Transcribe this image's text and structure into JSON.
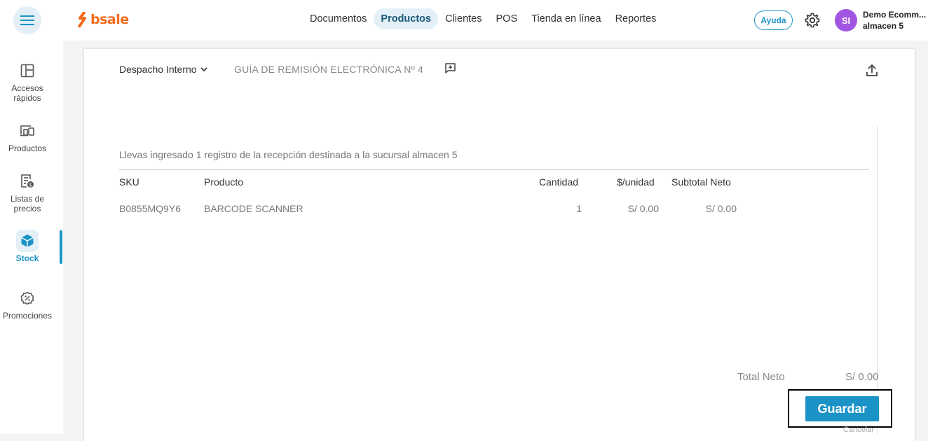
{
  "brand": {
    "name": "bsale",
    "color": "#f26b1d"
  },
  "accent": "#1c93c7",
  "topnav": {
    "items": [
      "Documentos",
      "Productos",
      "Clientes",
      "POS",
      "Tienda en línea",
      "Reportes"
    ],
    "active": "Productos"
  },
  "header": {
    "help_label": "Ayuda",
    "avatar_initials": "SI",
    "user_name": "Demo Ecomm...",
    "user_branch": "almacen 5"
  },
  "sidebar": {
    "items": [
      {
        "label_line1": "Accesos",
        "label_line2": "rápidos",
        "icon": "quick-access-icon"
      },
      {
        "label_line1": "Productos",
        "label_line2": "",
        "icon": "products-icon"
      },
      {
        "label_line1": "Listas de",
        "label_line2": "precios",
        "icon": "price-list-icon"
      },
      {
        "label_line1": "Stock",
        "label_line2": "",
        "icon": "stock-cube-icon",
        "active": true
      },
      {
        "label_line1": "Promociones",
        "label_line2": "",
        "icon": "promotions-icon"
      }
    ]
  },
  "document": {
    "type_label": "Despacho Interno",
    "title": "GUÍA DE REMISIÓN ELECTRÓNICA Nº 4",
    "info": "Llevas ingresado 1 registro de la recepción destinada a la sucursal almacen 5"
  },
  "table": {
    "headers": {
      "sku": "SKU",
      "product": "Producto",
      "qty": "Cantidad",
      "unit": "$/unidad",
      "subtotal": "Subtotal Neto"
    },
    "rows": [
      {
        "sku": "B0855MQ9Y6",
        "product": "BARCODE SCANNER",
        "qty": "1",
        "unit": "S/ 0.00",
        "subtotal": "S/ 0.00"
      }
    ]
  },
  "totals": {
    "label": "Total Neto",
    "value": "S/ 0.00"
  },
  "actions": {
    "save_label": "Guardar",
    "cancel_label": "Cancelar"
  }
}
